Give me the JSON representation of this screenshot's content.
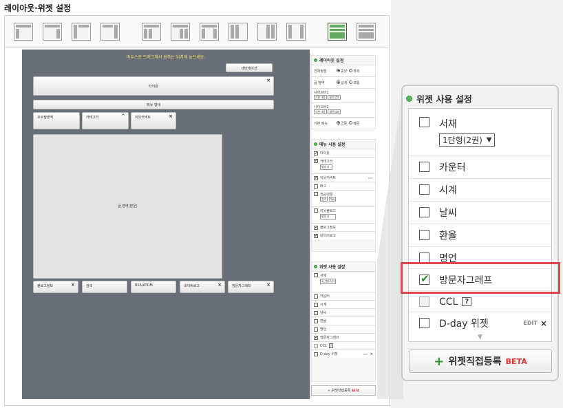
{
  "page_title": "레이아웃·위젯 설정",
  "canvas": {
    "hint": "마우스로 드래그해서 원하는 위치에 놓으세요.",
    "widgets": {
      "navi": "네비게이션",
      "title": "타이틀",
      "menu": "메뉴 형태",
      "profile": "프로필영역",
      "category": "카테고리",
      "echo": "이웃커넥트",
      "body": "글 영역(본문)",
      "bloginfo": "블로그정보",
      "search": "검색",
      "rss": "RSS/ATOM",
      "navilogo": "네이버로고",
      "visitgraph": "방문자그래프"
    }
  },
  "layout_settings": {
    "title": "레이아웃 설정",
    "align_label": "전체정렬",
    "align_opt1": "중앙",
    "align_opt2": "좌측",
    "width_label": "글 영역",
    "width_opt1": "넓게",
    "width_opt2": "보통",
    "sidebar1_label": "사이드바1",
    "sidebar1_sel1": "기본사용",
    "sidebar1_sel2": "펼친상태",
    "sidebar2_label": "사이드바2",
    "sidebar2_sel1": "기본사용",
    "sidebar2_sel2": "펼친상태",
    "menu_label": "기본 메뉴",
    "menu_opt1": "국문",
    "menu_opt2": "영문"
  },
  "menu_settings": {
    "title": "메뉴 사용 설정",
    "items": [
      {
        "label": "타이틀",
        "checked": true
      },
      {
        "label": "카테고리",
        "checked": true,
        "select": "펼치기"
      },
      {
        "label": "이웃커넥트",
        "checked": true,
        "edit": "EDIT"
      },
      {
        "label": "태그",
        "checked": false
      },
      {
        "label": "최근댓글",
        "checked": false,
        "select": "접기",
        "select2": "5줄"
      },
      {
        "label": "이웃블로그",
        "checked": false,
        "select": "펼치기"
      },
      {
        "label": "블로그정보",
        "checked": true
      },
      {
        "label": "네이버로고",
        "checked": true
      }
    ]
  },
  "widget_settings": {
    "title": "위젯 사용 설정",
    "items": [
      {
        "label": "서재",
        "checked": false,
        "select": "1단형(2권)"
      },
      {
        "label": "카운터",
        "checked": false
      },
      {
        "label": "시계",
        "checked": false
      },
      {
        "label": "날씨",
        "checked": false
      },
      {
        "label": "환율",
        "checked": false
      },
      {
        "label": "명언",
        "checked": false
      },
      {
        "label": "방문자그래프",
        "checked": true
      },
      {
        "label": "CCL",
        "checked": false,
        "help": "?"
      },
      {
        "label": "D-day 위젯",
        "checked": false,
        "edit": "EDIT"
      }
    ],
    "register_plus": "+",
    "register_label": "위젯직접등록",
    "register_beta": "BETA"
  },
  "colors": {
    "canvas": "#6a6e77",
    "accent_green": "#5cb85c",
    "highlight": "#e0454b"
  }
}
